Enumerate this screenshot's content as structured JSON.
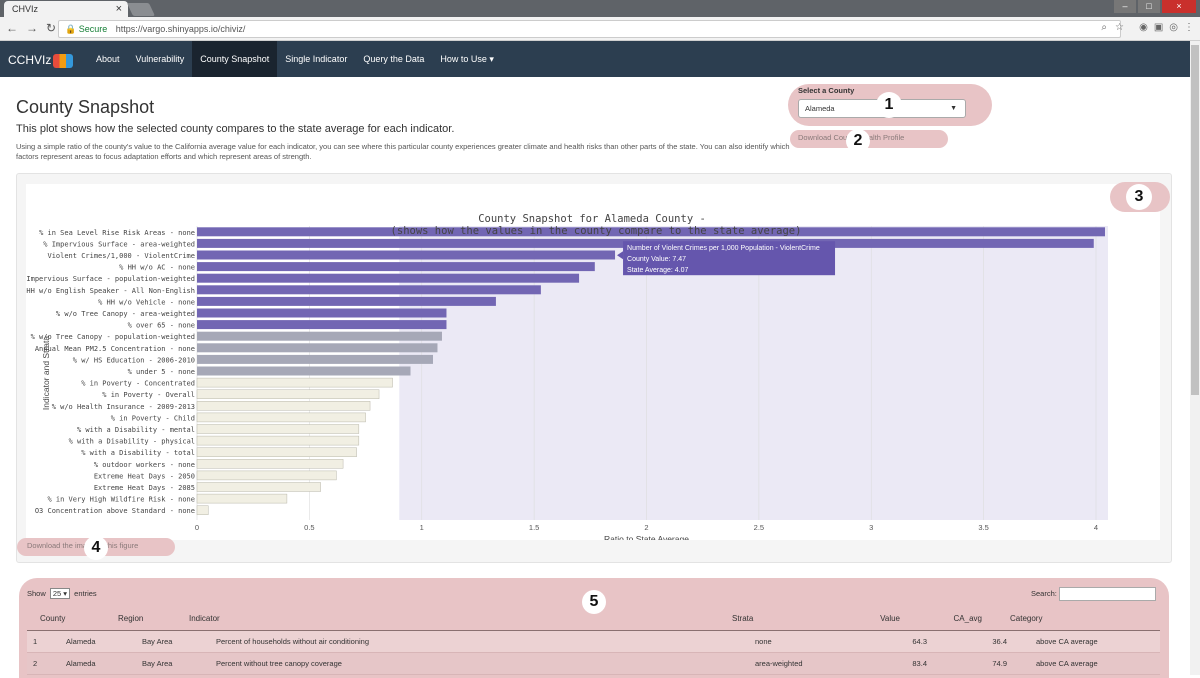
{
  "browser": {
    "tab_title": "CHVIz",
    "tab_close": "×",
    "nav": {
      "back": "←",
      "forward": "→",
      "reload": "↻"
    },
    "secure_label": "Secure",
    "url": "https://vargo.shinyapps.io/chiviz/"
  },
  "navbar": {
    "brand": "CCHVIz",
    "items": [
      {
        "label": "About",
        "active": false
      },
      {
        "label": "Vulnerability",
        "active": false
      },
      {
        "label": "County Snapshot",
        "active": true
      },
      {
        "label": "Single Indicator",
        "active": false
      },
      {
        "label": "Query the Data",
        "active": false
      },
      {
        "label": "How to Use ▾",
        "active": false
      }
    ]
  },
  "page": {
    "title": "County Snapshot",
    "subtitle": "This plot shows how the selected county compares to the state average for each indicator.",
    "description": "Using a simple ratio of the county's value to the California average value for each indicator, you can see where this particular county experiences greater climate and health risks than other parts of the state. You can also identify which factors represent areas to focus adaptation efforts and which represent areas of strength."
  },
  "county_selector": {
    "label": "Select a County",
    "value": "Alameda",
    "download_profile": "Download County Health Profile"
  },
  "badges": {
    "b1": "1",
    "b2": "2",
    "b3": "3",
    "b4": "4",
    "b5": "5"
  },
  "download_figure": "Download the image of this figure",
  "colors": {
    "purple": "#7266b3",
    "gray": "#a6a8b7",
    "cream": "#f1efe3",
    "highlight": "#e8c4c6",
    "navbar": "#2c3e50"
  },
  "chart_data": {
    "type": "bar",
    "orientation": "horizontal",
    "title": "County Snapshot for Alameda County -",
    "subtitle": "(shows how the values in the county compare to the state average)",
    "xlabel": "Ratio to State Average",
    "ylabel": "Indicator and Strata",
    "xlim": [
      0,
      4.05
    ],
    "xticks": [
      "0",
      "0.5",
      "1",
      "1.5",
      "2",
      "2.5",
      "3",
      "3.5",
      "4"
    ],
    "categories": [
      "% in Sea Level Rise Risk Areas - none",
      "% Impervious Surface - area-weighted",
      "Violent Crimes/1,000 - ViolentCrime",
      "% HH w/o AC - none",
      "% Impervious Surface - population-weighted",
      "% HH w/o English Speaker - All Non-English",
      "% HH w/o Vehicle - none",
      "% w/o Tree Canopy - area-weighted",
      "% over 65 - none",
      "% w/o Tree Canopy - population-weighted",
      "Annual Mean PM2.5 Concentration - none",
      "% w/ HS Education - 2006-2010",
      "% under 5 - none",
      "% in Poverty - Concentrated",
      "% in Poverty - Overall",
      "% w/o Health Insurance - 2009-2013",
      "% in Poverty - Child",
      "% with a Disability - mental",
      "% with a Disability - physical",
      "% with a Disability - total",
      "% outdoor workers - none",
      "Extreme Heat Days - 2050",
      "Extreme Heat Days - 2085",
      "% in Very High Wildfire Risk - none",
      "O3 Concentration above Standard - none"
    ],
    "values": [
      4.04,
      3.99,
      1.86,
      1.77,
      1.7,
      1.53,
      1.33,
      1.11,
      1.11,
      1.09,
      1.07,
      1.05,
      0.95,
      0.87,
      0.81,
      0.77,
      0.75,
      0.72,
      0.72,
      0.71,
      0.65,
      0.62,
      0.55,
      0.4,
      0.05
    ],
    "color_groups": [
      "purple",
      "purple",
      "purple",
      "purple",
      "purple",
      "purple",
      "purple",
      "purple",
      "purple",
      "gray",
      "gray",
      "gray",
      "gray",
      "cream",
      "cream",
      "cream",
      "cream",
      "cream",
      "cream",
      "cream",
      "cream",
      "cream",
      "cream",
      "cream",
      "cream"
    ],
    "tooltip": {
      "line1": "Number of Violent Crimes per 1,000 Population - ViolentCrime",
      "line2": "County Value: 7.47",
      "line3": "State Average: 4.07"
    }
  },
  "table": {
    "show_label": "Show",
    "entries_value": "25",
    "entries_label": "entries",
    "search_label": "Search:",
    "columns": [
      "County",
      "Region",
      "Indicator",
      "Strata",
      "Value",
      "CA_avg",
      "Category"
    ],
    "rows": [
      [
        "1",
        "Alameda",
        "Bay Area",
        "Percent of households without air conditioning",
        "none",
        "64.3",
        "36.4",
        "above CA average"
      ],
      [
        "2",
        "Alameda",
        "Bay Area",
        "Percent without tree canopy coverage",
        "area-weighted",
        "83.4",
        "74.9",
        "above CA average"
      ]
    ]
  }
}
